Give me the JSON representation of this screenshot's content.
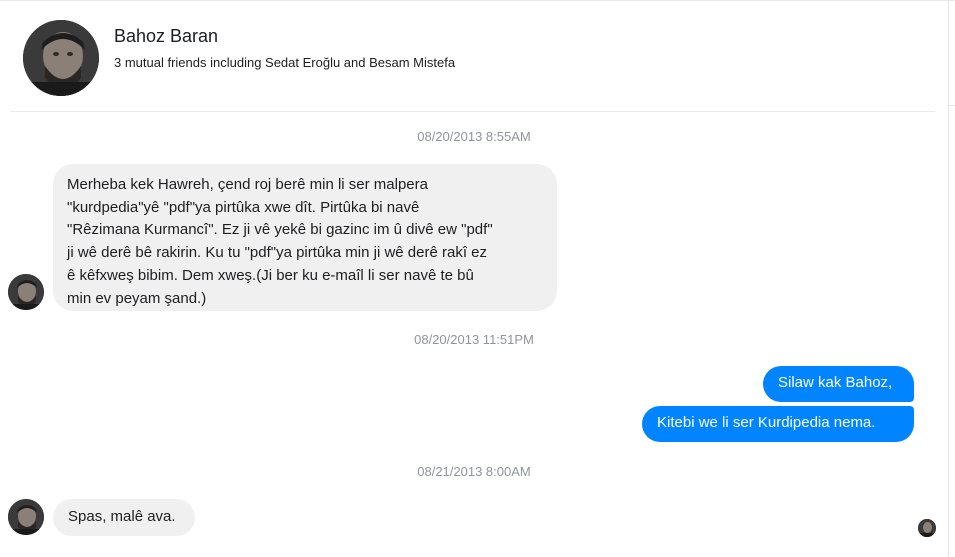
{
  "header": {
    "name": "Bahoz Baran",
    "subtitle": "3 mutual friends including Sedat Eroğlu and Besam Mistefa"
  },
  "thread": {
    "timestamps": [
      "08/20/2013 8:55AM",
      "08/20/2013 11:51PM",
      "08/21/2013 8:00AM"
    ],
    "messages": [
      {
        "from": "Bahoz Baran",
        "lines": [
          "Merheba kek Hawreh, çend roj berê min li ser malpera",
          "\"kurdpedia\"yê \"pdf\"ya pirtûka xwe dît. Pirtûka bi navê",
          "\"Rêzimana Kurmancî\". Ez ji vê yekê bi gazinc im û divê ew \"pdf\"",
          "ji wê derê bê rakirin. Ku tu \"pdf\"ya pirtûka min ji wê derê rakî ez",
          "ê kêfxweş bibim. Dem xweş.(Ji ber ku e-maîl li ser navê te bû",
          "min ev peyam şand.)"
        ]
      },
      {
        "from": "me",
        "text": "Silaw kak Bahoz,"
      },
      {
        "from": "me",
        "text": "Kitebi we li ser Kurdipedia nema."
      },
      {
        "from": "Bahoz Baran",
        "text": "Spas, malê ava."
      }
    ]
  },
  "colors": {
    "incoming_bubble": "#f1f0f0",
    "outgoing_bubble": "#0084ff",
    "timestamp": "#90949c"
  },
  "icons": {
    "contact_avatar": "profile-photo",
    "seen_indicator": "profile-photo-mini"
  }
}
